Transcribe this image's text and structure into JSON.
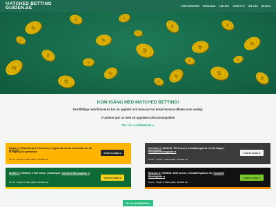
{
  "header": {
    "logo_line1_a": "M",
    "logo_line1_b": "ATCHED BETTING",
    "logo_line2": "GUIDEN.SE",
    "nav": [
      "SPELSERVERN",
      "BONUSAR",
      "LÄR DIG",
      "VERKTYG",
      "OM OSS",
      "BLOGG"
    ],
    "bg_color": "#1f6b52"
  },
  "intro": {
    "title": "KOM IGÅNG MED MATCHED BETTING!",
    "p1": "De tillfälliga restriktionerna har nu upphört och bonusar har börjat komma tillbaka som vanligt.",
    "p2": "Vi arbetar just nu med att uppdatera alla bonusguider!",
    "link": "TILL ALLA BONUSAR ➡"
  },
  "cards": [
    {
      "name": "Betfair",
      "line1a": "Betfair ➡",
      "line1b": " | Riskfritt spel 1 00 kronor | Öppna ditt konto hos Betfair för att få tillgång till spelbonus!",
      "sub": "18+ år · Regler & villkor gäller, skrollbar ser",
      "button": "STARTA GUIDE ➡",
      "accent": "#ffb400"
    },
    {
      "name": "ComeOn",
      "line1a": "ComeOn ➡",
      "line1b": " | BONUS: 700 kronor | Omsättningskrav x1 | 60 Dagar | ",
      "line1c": "Komplett Bonusguide ➡",
      "sub": "18+ år · Regler & villkor gäller, skrollbar ser",
      "button": "STARTA GUIDE ➡",
      "accent": "#3b3b3b"
    },
    {
      "name": "Bet365",
      "line1a": "Bet365 ➡",
      "line1b": " | BONUS: 1 200 kronor | Gratisspel | ",
      "line1c": "Komplett Bonusguide ➡",
      "sub": "18+ år · Regler & villkor gäller, skrollbar ser",
      "button": "STARTA GUIDE ➡",
      "accent": "#0e6a35"
    },
    {
      "name": "Betsson",
      "line1a": "Betsson ➡",
      "line1b": " | BONUS: 1000 kronor | Omsättningskrav x6 | ",
      "line1c": "Komplett Bonusguide ➡",
      "sub": "18+ år · Regler & villkor gäller, skrollbar ser",
      "button": "STARTA GUIDE ➡",
      "accent": "#111111"
    }
  ],
  "footer_button": "TILL ALLA BONUSAR ➡",
  "colors": {
    "accent_green": "#29b57a",
    "coin_gold": "#e0b400"
  }
}
